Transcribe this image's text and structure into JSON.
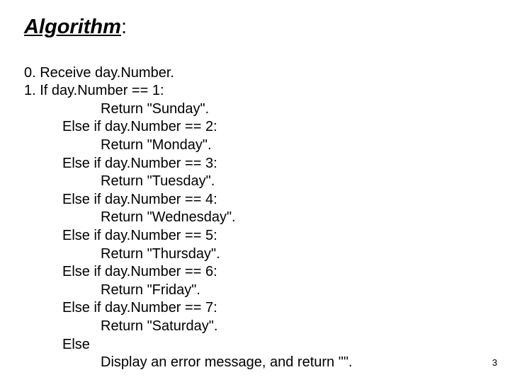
{
  "title": "Algorithm",
  "title_colon": ":",
  "lines": {
    "l0": "0. Receive day.Number.",
    "l1": "1. If day.Number == 1:",
    "l2": "Return \"Sunday\".",
    "l3": "Else if day.Number == 2:",
    "l4": "Return \"Monday\".",
    "l5": "Else if day.Number == 3:",
    "l6": "Return \"Tuesday\".",
    "l7": "Else if day.Number == 4:",
    "l8": "Return \"Wednesday\".",
    "l9": "Else if day.Number == 5:",
    "l10": "Return \"Thursday\".",
    "l11": "Else if day.Number == 6:",
    "l12": "Return \"Friday\".",
    "l13": "Else if day.Number == 7:",
    "l14": "Return \"Saturday\".",
    "l15": "Else",
    "l16": "Display an error message, and return \"\"."
  },
  "page_number": "3"
}
